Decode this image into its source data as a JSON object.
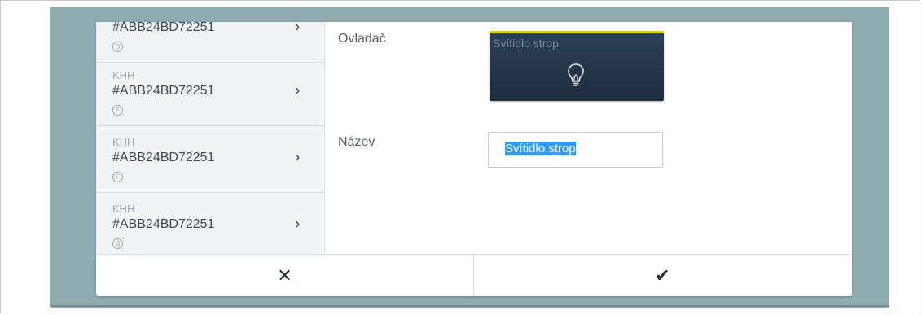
{
  "devices": [
    {
      "type": "",
      "id": "#ABB24BD72251",
      "badge": "D"
    },
    {
      "type": "KHH",
      "id": "#ABB24BD72251",
      "badge": "E"
    },
    {
      "type": "KHH",
      "id": "#ABB24BD72251",
      "badge": "F"
    },
    {
      "type": "KHH",
      "id": "#ABB24BD72251",
      "badge": "G"
    }
  ],
  "chevron": "›",
  "form": {
    "control_label": "Ovladač",
    "name_label": "Název",
    "name_value": "Svítidlo strop"
  },
  "tile": {
    "title": "Svítidlo strop",
    "icon": "lightbulb-icon",
    "accent_color": "#d6d400",
    "background_color": "#1f2d40"
  },
  "footer": {
    "cancel_icon": "✕",
    "confirm_icon": "✔"
  }
}
